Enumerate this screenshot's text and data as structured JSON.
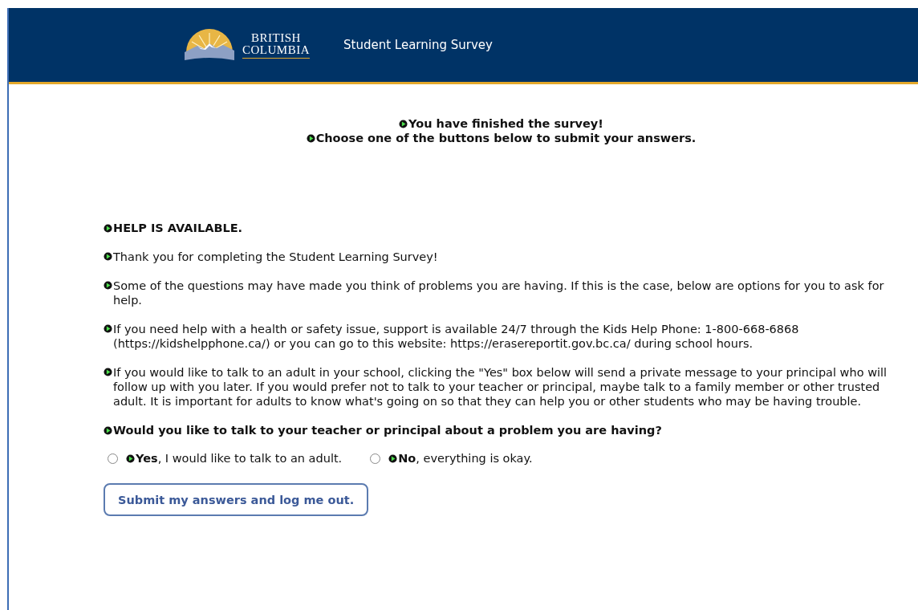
{
  "header": {
    "logo_top": "BRITISH",
    "logo_bottom": "COLUMBIA",
    "title": "Student Learning Survey"
  },
  "finished": [
    "You have finished the survey!",
    "Choose one of the buttons below to submit your answers."
  ],
  "heading": "HELP IS AVAILABLE.",
  "paragraphs": [
    "Thank you for completing the Student Learning Survey!",
    "Some of the questions may have made you think of problems you are having. If this is the case, below are options for you to ask for help.",
    "If you need help with a health or safety issue, support is available 24/7 through the Kids Help Phone: 1-800-668-6868 (https://kidshelpphone.ca/) or you can go to this website: https://erasereportit.gov.bc.ca/ during school hours.",
    "If you would like to talk to an adult in your school, clicking the \"Yes\" box below will send a private message to your principal who will follow up with you later. If you would prefer not to talk to your teacher or principal, maybe talk to a family member or other trusted adult. It is important for adults to know what's going on so that they can help you or other students who may be having trouble."
  ],
  "question": "Would you like to talk to your teacher or principal about a problem you are having?",
  "options": [
    {
      "label": "**Yes**, I would like to talk to an adult.",
      "selected": false
    },
    {
      "label": "**No**, everything is okay.",
      "selected": false
    }
  ],
  "submit_button": "Submit my answers and log me out."
}
